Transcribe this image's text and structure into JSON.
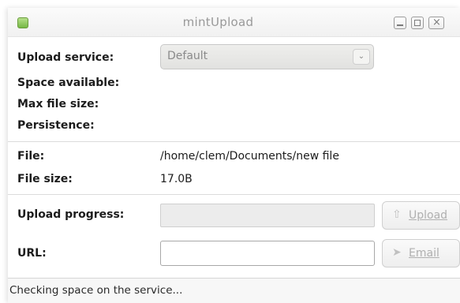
{
  "window": {
    "title": "mintUpload",
    "icon": "mintupload-app-icon",
    "controls": {
      "minimize": "minimize",
      "maximize": "maximize",
      "close": "×"
    }
  },
  "form": {
    "upload_service_label": "Upload service:",
    "upload_service_value": "Default",
    "space_available_label": "Space available:",
    "max_file_size_label": "Max file size:",
    "persistence_label": "Persistence:",
    "file_label": "File:",
    "file_value": "/home/clem/Documents/new file",
    "file_size_label": "File size:",
    "file_size_value": "17.0B",
    "upload_progress_label": "Upload progress:",
    "upload_progress_value": 0,
    "url_label": "URL:",
    "url_value": ""
  },
  "buttons": {
    "upload_label": "Upload",
    "email_label": "Email"
  },
  "statusbar": {
    "text": "Checking space on the service..."
  }
}
